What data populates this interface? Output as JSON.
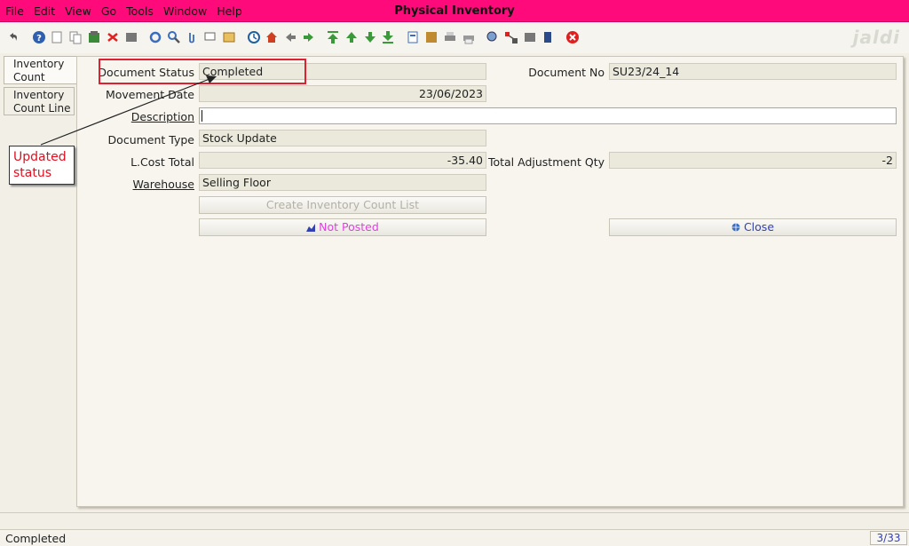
{
  "menu": {
    "file": "File",
    "edit": "Edit",
    "view": "View",
    "go": "Go",
    "tools": "Tools",
    "window": "Window",
    "help": "Help"
  },
  "window": {
    "title": "Physical Inventory"
  },
  "toolbar": {
    "logo": "jaldi",
    "icons": [
      "undo-icon",
      "help-icon",
      "new-record-icon",
      "copy-record-icon",
      "save-icon",
      "delete-icon",
      "print-preview-icon",
      "refresh-icon",
      "find-icon",
      "attachment-icon",
      "chat-icon",
      "history-icon",
      "history-detail-icon",
      "home-icon",
      "back-icon",
      "forward-icon",
      "first-record-icon",
      "previous-record-icon",
      "next-record-icon",
      "last-record-icon",
      "report-icon",
      "archive-icon",
      "print-icon",
      "print-all-icon",
      "zoom-icon",
      "workflow-icon",
      "request-icon",
      "product-info-icon",
      "exit-icon"
    ]
  },
  "tabs": [
    {
      "label1": "Inventory",
      "label2": "Count"
    },
    {
      "label1": "Inventory",
      "label2": "Count Line"
    }
  ],
  "form": {
    "document_status": {
      "label": "Document Status",
      "value": "Completed"
    },
    "document_no": {
      "label": "Document No",
      "value": "SU23/24_14"
    },
    "movement_date": {
      "label": "Movement Date",
      "value": "23/06/2023"
    },
    "description": {
      "label": "Description",
      "value": ""
    },
    "document_type": {
      "label": "Document Type",
      "value": "Stock Update"
    },
    "lcost_total": {
      "label": "L.Cost Total",
      "value": "-35.40"
    },
    "total_adjustment_qty": {
      "label": "Total Adjustment Qty",
      "value": "-2"
    },
    "warehouse": {
      "label": "Warehouse",
      "value": "Selling Floor"
    },
    "create_list_button": "Create Inventory Count List",
    "posted_button": "Not Posted",
    "close_button": "Close"
  },
  "annotation": {
    "line1": "Updated",
    "line2": "status"
  },
  "status": {
    "message": "Completed",
    "record_count": "3/33"
  },
  "colors": {
    "title_bar": "#ff0a7b",
    "highlight": "#e02030",
    "posted_text": "#e040e0",
    "close_text": "#3341b0"
  }
}
